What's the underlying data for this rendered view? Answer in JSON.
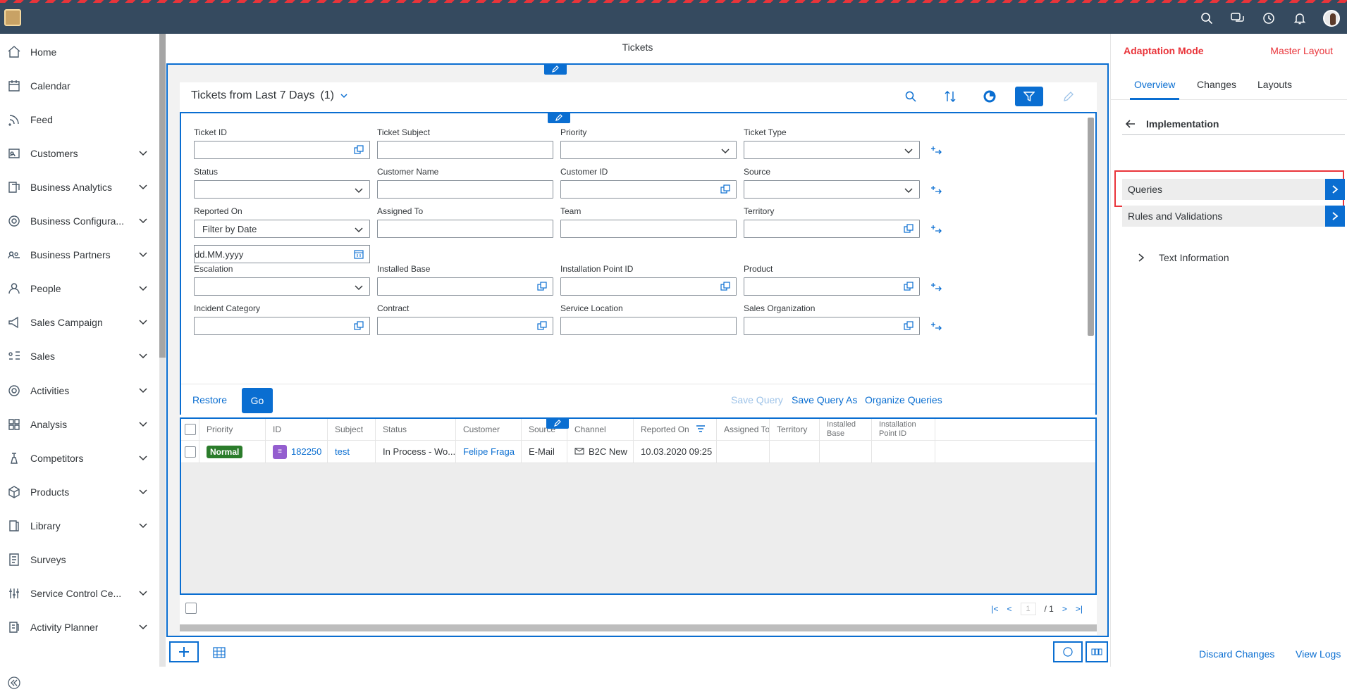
{
  "main": {
    "title": "Tickets"
  },
  "sidebar": {
    "items": [
      {
        "label": "Home",
        "icon": "home-icon",
        "expandable": false
      },
      {
        "label": "Calendar",
        "icon": "calendar-icon",
        "expandable": false
      },
      {
        "label": "Feed",
        "icon": "feed-icon",
        "expandable": false
      },
      {
        "label": "Customers",
        "icon": "customers-icon",
        "expandable": true
      },
      {
        "label": "Business Analytics",
        "icon": "analytics-icon",
        "expandable": true
      },
      {
        "label": "Business Configura...",
        "icon": "configuration-icon",
        "expandable": true
      },
      {
        "label": "Business Partners",
        "icon": "partners-icon",
        "expandable": true
      },
      {
        "label": "People",
        "icon": "people-icon",
        "expandable": true
      },
      {
        "label": "Sales Campaign",
        "icon": "campaign-icon",
        "expandable": true
      },
      {
        "label": "Sales",
        "icon": "sales-icon",
        "expandable": true
      },
      {
        "label": "Activities",
        "icon": "activities-icon",
        "expandable": true
      },
      {
        "label": "Analysis",
        "icon": "analysis-icon",
        "expandable": true
      },
      {
        "label": "Competitors",
        "icon": "competitors-icon",
        "expandable": true
      },
      {
        "label": "Products",
        "icon": "products-icon",
        "expandable": true
      },
      {
        "label": "Library",
        "icon": "library-icon",
        "expandable": true
      },
      {
        "label": "Surveys",
        "icon": "surveys-icon",
        "expandable": false
      },
      {
        "label": "Service Control Ce...",
        "icon": "service-control-icon",
        "expandable": true
      },
      {
        "label": "Activity Planner",
        "icon": "planner-icon",
        "expandable": true
      }
    ]
  },
  "query": {
    "title": "Tickets from Last 7 Days",
    "count": "(1)"
  },
  "filters": {
    "ticket_id": {
      "label": "Ticket ID",
      "value": ""
    },
    "ticket_subject": {
      "label": "Ticket Subject",
      "value": ""
    },
    "priority": {
      "label": "Priority",
      "value": ""
    },
    "ticket_type": {
      "label": "Ticket Type",
      "value": ""
    },
    "status": {
      "label": "Status",
      "value": ""
    },
    "customer_name": {
      "label": "Customer Name",
      "value": ""
    },
    "customer_id": {
      "label": "Customer ID",
      "value": ""
    },
    "source": {
      "label": "Source",
      "value": ""
    },
    "reported_on": {
      "label": "Reported On",
      "value": "Filter by Date",
      "date_placeholder": "dd.MM.yyyy"
    },
    "assigned_to": {
      "label": "Assigned To",
      "value": ""
    },
    "team": {
      "label": "Team",
      "value": ""
    },
    "territory": {
      "label": "Territory",
      "value": ""
    },
    "escalation": {
      "label": "Escalation",
      "value": ""
    },
    "installed_base": {
      "label": "Installed Base",
      "value": ""
    },
    "installation_point_id": {
      "label": "Installation Point ID",
      "value": ""
    },
    "product": {
      "label": "Product",
      "value": ""
    },
    "incident_category": {
      "label": "Incident Category",
      "value": ""
    },
    "contract": {
      "label": "Contract",
      "value": ""
    },
    "service_location": {
      "label": "Service Location",
      "value": ""
    },
    "sales_organization": {
      "label": "Sales Organization",
      "value": ""
    }
  },
  "actions": {
    "restore": "Restore",
    "go": "Go",
    "save_query": "Save Query",
    "save_query_as": "Save Query As",
    "organize_queries": "Organize Queries"
  },
  "table": {
    "columns": [
      "Priority",
      "ID",
      "Subject",
      "Status",
      "Customer",
      "Source",
      "Channel",
      "Reported On",
      "Assigned To",
      "Territory",
      "Installed Base",
      "Installation Point ID"
    ],
    "rows": [
      {
        "priority": "Normal",
        "id": "182250",
        "subject": "test",
        "status": "In Process - Wo...",
        "customer": "Felipe Fraga",
        "source": "E-Mail",
        "channel": "B2C New",
        "reported_on": "10.03.2020 09:25",
        "assigned_to": "",
        "territory": "",
        "installed_base": "",
        "installation_point_id": ""
      }
    ],
    "pager": {
      "page": "1",
      "of": "/ 1"
    }
  },
  "adaptation": {
    "title": "Adaptation Mode",
    "master_layout": "Master Layout",
    "tabs": [
      "Overview",
      "Changes",
      "Layouts"
    ],
    "section": "Implementation",
    "items": [
      "Queries",
      "Rules and Validations"
    ],
    "text_information": "Text Information",
    "discard": "Discard Changes",
    "view_logs": "View Logs"
  },
  "colors": {
    "shell": "#354a5f",
    "accent": "#0a6ed1",
    "adaptation": "#e9343a",
    "priority_normal": "#2b7c2b"
  }
}
